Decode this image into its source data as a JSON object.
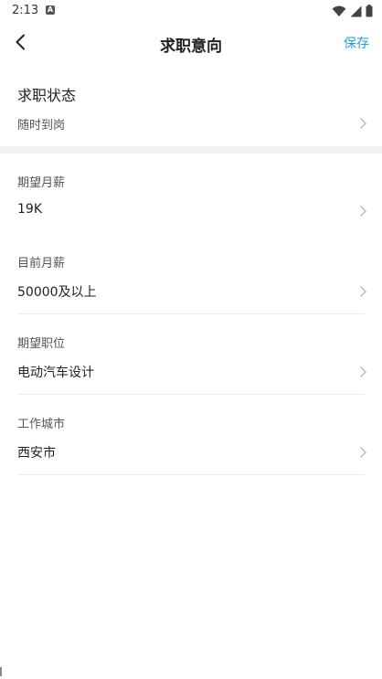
{
  "status_bar": {
    "time": "2:13",
    "notification_icon": "A"
  },
  "header": {
    "title": "求职意向",
    "save_label": "保存"
  },
  "job_status": {
    "heading": "求职状态",
    "value": "随时到岗"
  },
  "fields": [
    {
      "label": "期望月薪",
      "value": "19K"
    },
    {
      "label": "目前月薪",
      "value": "50000及以上"
    },
    {
      "label": "期望职位",
      "value": "电动汽车设计"
    },
    {
      "label": "工作城市",
      "value": "西安市"
    }
  ],
  "colors": {
    "accent": "#2a9fd6",
    "band": "#f2f2f2",
    "divider": "#ececec"
  }
}
